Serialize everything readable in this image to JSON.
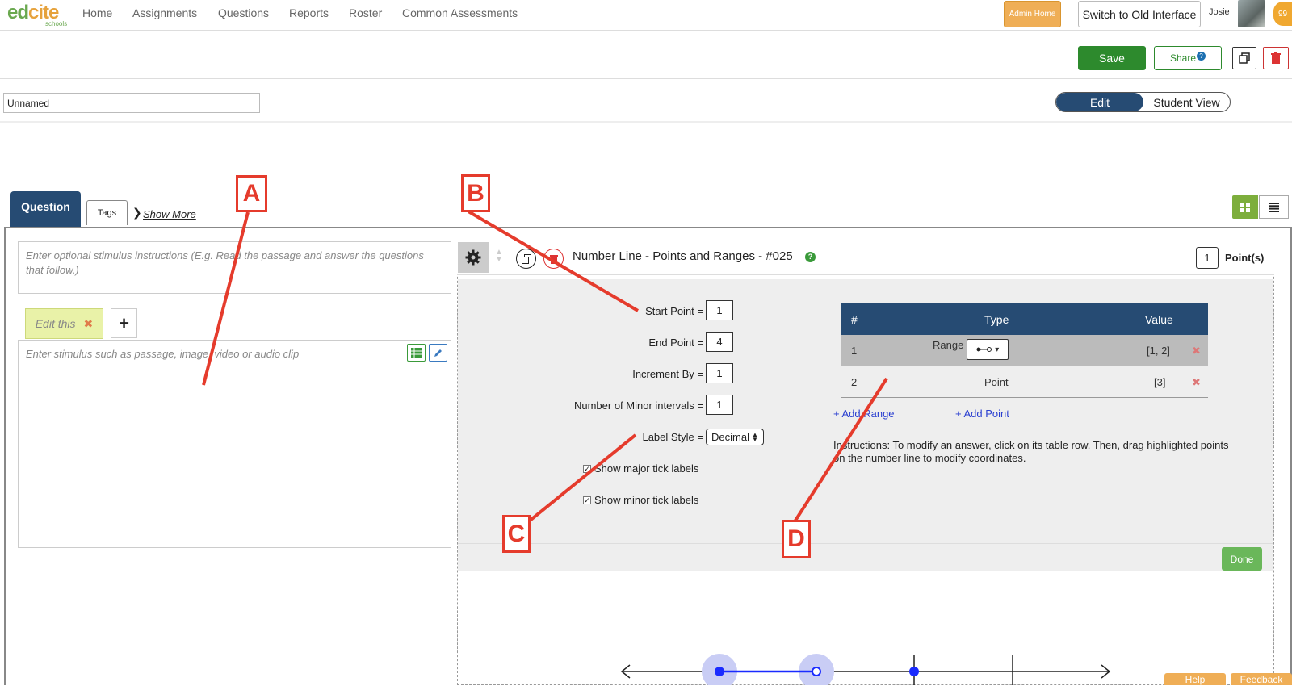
{
  "nav": {
    "logo_ed": "ed",
    "logo_cite": "cite",
    "logo_sub": "schools",
    "links": [
      "Home",
      "Assignments",
      "Questions",
      "Reports",
      "Roster",
      "Common Assessments"
    ],
    "admin_home": "Admin Home",
    "switch_old": "Switch to Old Interface",
    "user": "Josie",
    "notif_count": "99"
  },
  "toolbar": {
    "save": "Save",
    "share": "Share",
    "share_help": "?"
  },
  "title_row": {
    "name_value": "Unnamed",
    "edit": "Edit",
    "student_view": "Student View"
  },
  "tabs": {
    "question": "Question",
    "tags": "Tags",
    "show_more": "Show More"
  },
  "stimulus": {
    "instructions_placeholder": "Enter optional stimulus instructions (E.g. Read the passage and answer the questions that follow.)",
    "edit_this": "Edit this",
    "body_placeholder": "Enter stimulus such as passage, image, video or audio clip"
  },
  "question": {
    "title": "Number Line - Points and Ranges - #025",
    "points": "1",
    "points_label": "Point(s)",
    "fields": [
      {
        "label": "Start Point =",
        "value": "1"
      },
      {
        "label": "End Point =",
        "value": "4"
      },
      {
        "label": "Increment By =",
        "value": "1"
      },
      {
        "label": "Number of Minor intervals =",
        "value": "1"
      }
    ],
    "label_style_label": "Label Style =",
    "label_style_value": "Decimal",
    "show_major": "Show major tick labels",
    "show_minor": "Show minor tick labels",
    "table_headers": [
      "#",
      "Type",
      "Value"
    ],
    "rows": [
      {
        "n": "1",
        "type": "Range",
        "value": "[1, 2]"
      },
      {
        "n": "2",
        "type": "Point",
        "value": "[3]"
      }
    ],
    "add_range": "+ Add Range",
    "add_point": "+ Add Point",
    "instructions": "Instructions: To modify an answer, click on its table row. Then, drag highlighted points on the number line to modify coordinates.",
    "done": "Done"
  },
  "callouts": [
    "A",
    "B",
    "C",
    "D"
  ],
  "footer": {
    "help": "Help",
    "feedback": "Feedback"
  },
  "colors": {
    "navy": "#264b73",
    "green": "#2d8a2d",
    "orange": "#efae56",
    "annotation_red": "#e53b2c",
    "number_line_blue": "#1a2bff"
  }
}
